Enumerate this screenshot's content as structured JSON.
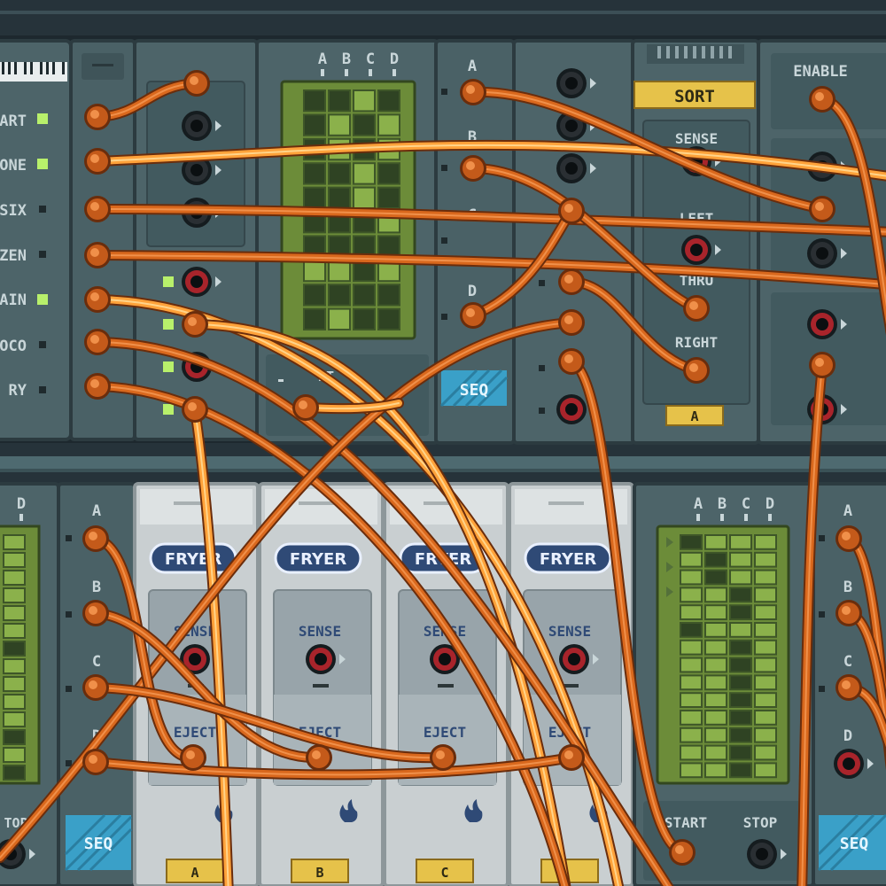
{
  "colors": {
    "background": "#1d282e",
    "module": "#4d6469",
    "module_dark": "#3a4d52",
    "fryer": "#c9cfd1",
    "screen": "#6c8c39",
    "cell_on": "#2f4323",
    "cable": "#d9681d",
    "cable_hot": "#ffa23a",
    "led_on": "#b8f06b",
    "tag_yellow": "#e6c24a",
    "seq_badge": "#3aa0c8"
  },
  "toggles": {
    "labels": [
      "ART",
      "ONE",
      "SIX",
      "ZEN",
      "AIN",
      "OCO",
      "RY"
    ],
    "led_states": [
      true,
      true,
      false,
      false,
      true,
      false,
      false
    ]
  },
  "leds_column": [
    true,
    true,
    true,
    true
  ],
  "seq_top": {
    "columns": [
      "A",
      "B",
      "C",
      "D"
    ],
    "outputs": [
      "A",
      "B",
      "C",
      "D"
    ],
    "badge": "SEQ",
    "label_fragment": "RT",
    "grid": [
      [
        1,
        1,
        0,
        1
      ],
      [
        1,
        0,
        1,
        0
      ],
      [
        1,
        0,
        1,
        0
      ],
      [
        1,
        1,
        0,
        1
      ],
      [
        1,
        1,
        0,
        1
      ],
      [
        1,
        1,
        1,
        0
      ],
      [
        1,
        1,
        1,
        1
      ],
      [
        0,
        0,
        1,
        0
      ],
      [
        1,
        1,
        1,
        1
      ],
      [
        1,
        0,
        1,
        1
      ]
    ]
  },
  "sort": {
    "title": "SORT",
    "sense": "SENSE",
    "left": "LEFT",
    "thru": "THRU",
    "right": "RIGHT",
    "tag": "A"
  },
  "enable_module": {
    "title": "ENABLE"
  },
  "seq_bottom_left": {
    "column_fragment": "D",
    "outputs": [
      "A",
      "B",
      "C",
      "D"
    ],
    "stop": "TOP",
    "badge": "SEQ",
    "grid": [
      [
        0
      ],
      [
        0
      ],
      [
        0
      ],
      [
        0
      ],
      [
        0
      ],
      [
        0
      ],
      [
        1
      ],
      [
        0
      ],
      [
        0
      ],
      [
        0
      ],
      [
        0
      ],
      [
        1
      ],
      [
        0
      ],
      [
        1
      ]
    ]
  },
  "fryers": [
    {
      "brand": "FRYER",
      "sense": "SENSE",
      "eject": "EJECT",
      "tag": "A"
    },
    {
      "brand": "FRYER",
      "sense": "SENSE",
      "eject": "EJECT",
      "tag": "B"
    },
    {
      "brand": "FRYER",
      "sense": "SENSE",
      "eject": "EJECT",
      "tag": "C"
    },
    {
      "brand": "FRYER",
      "sense": "SENSE",
      "eject": "EJECT",
      "tag": ""
    }
  ],
  "seq_bottom_right": {
    "columns": [
      "A",
      "B",
      "C",
      "D"
    ],
    "start": "START",
    "stop": "STOP",
    "grid": [
      [
        1,
        0,
        0,
        0
      ],
      [
        0,
        1,
        0,
        0
      ],
      [
        0,
        1,
        0,
        0
      ],
      [
        0,
        0,
        1,
        0
      ],
      [
        0,
        0,
        1,
        0
      ],
      [
        1,
        0,
        0,
        0
      ],
      [
        0,
        0,
        1,
        0
      ],
      [
        0,
        0,
        1,
        0
      ],
      [
        0,
        0,
        1,
        0
      ],
      [
        0,
        0,
        1,
        0
      ],
      [
        0,
        0,
        1,
        0
      ],
      [
        0,
        0,
        1,
        0
      ],
      [
        0,
        0,
        1,
        0
      ],
      [
        0,
        0,
        1,
        0
      ]
    ]
  },
  "seq_bottom_far_right": {
    "outputs": [
      "A",
      "B",
      "C",
      "D"
    ],
    "badge": "SEQ"
  }
}
